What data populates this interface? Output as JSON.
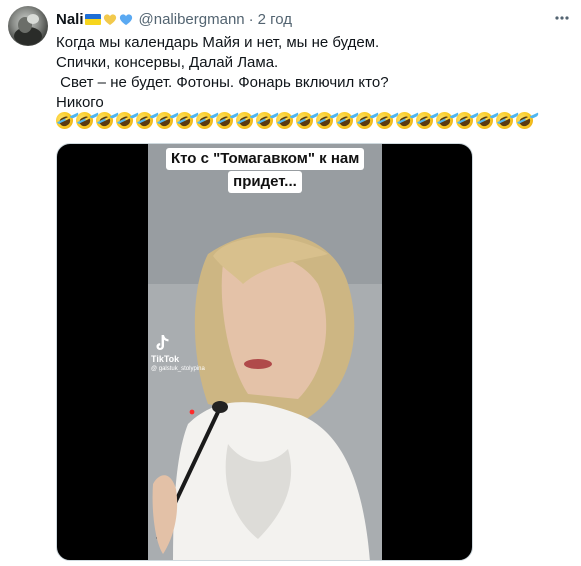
{
  "tweet": {
    "author_name": "Nali",
    "author_handle": "@nalibergmann",
    "separator": "·",
    "time": "2 год",
    "colors": {
      "flag_blue": "#1f6fd6",
      "flag_yellow": "#f7d51d",
      "heart_yellow": "#f2c94c",
      "heart_blue": "#5aa9f2"
    },
    "text_lines": [
      "Когда мы календарь Майя и нет, мы не будем.",
      "Спички, консервы, Далай Лама.",
      " Свет – не будет. Фотоны. Фонарь включил кто?",
      "Никого"
    ],
    "emoji": {
      "name": "rolling-on-the-floor-laughing",
      "count": 24
    }
  },
  "media": {
    "caption_lines": [
      "Кто с \"Томагавком\" к нам",
      "придет..."
    ],
    "watermark_brand": "TikTok",
    "watermark_user": "@ galstuk_stolypina"
  }
}
